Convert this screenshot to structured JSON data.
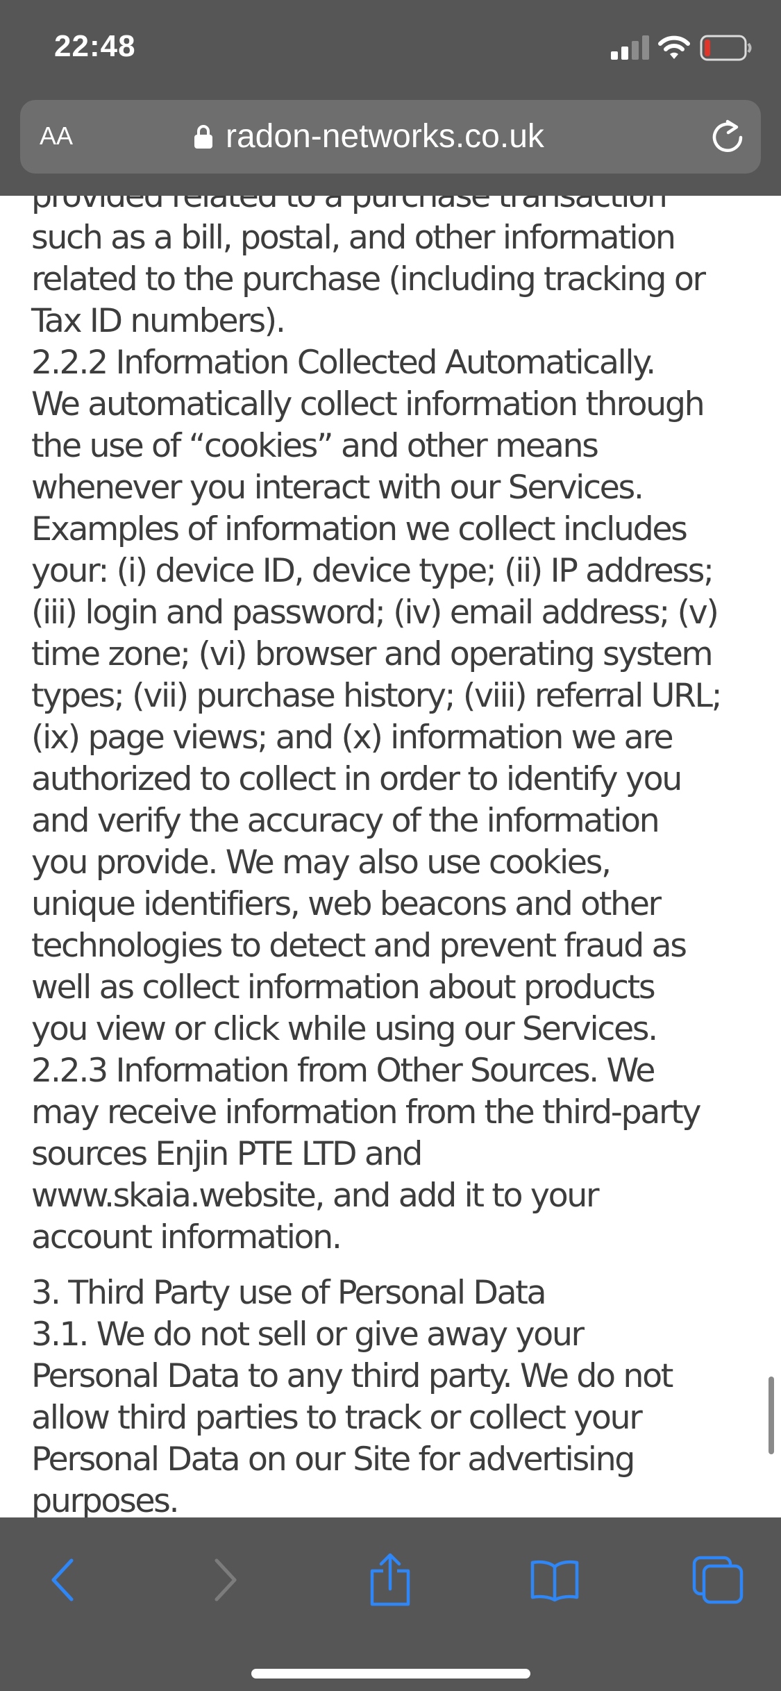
{
  "status_bar": {
    "time": "22:48"
  },
  "url_bar": {
    "text_size_label": "AA",
    "domain": "radon-networks.co.uk",
    "icons": [
      "lock-icon",
      "reload-icon"
    ]
  },
  "content": {
    "paragraph_1": [
      "provided related to a purchase transaction",
      "such as a bill, postal, and other information",
      "related to the purchase (including tracking or",
      "Tax ID numbers).",
      "2.2.2 Information Collected Automatically.",
      "We automatically collect information through",
      "the use of “cookies” and other means",
      "whenever you interact with our Services.",
      "Examples of information we collect includes",
      "your: (i) device ID, device type; (ii) IP address;",
      "(iii) login and password; (iv) email address; (v)",
      "time zone; (vi) browser and operating system",
      "types; (vii) purchase history; (viii) referral URL;",
      "(ix) page views; and (x) information we are",
      "authorized to collect in order to identify you",
      "and verify the accuracy of the information",
      "you provide. We may also use cookies,",
      "unique identifiers, web beacons and other",
      "technologies to detect and prevent fraud as",
      "well as collect information about products",
      "you view or click while using our Services.",
      "2.2.3 Information from Other Sources. We",
      "may receive information from the third-party",
      "sources Enjin PTE LTD and",
      "www.skaia.website, and add it to your",
      "account information."
    ],
    "paragraph_2": [
      "3. Third Party use of Personal Data",
      "3.1. We do not sell or give away your",
      "Personal Data to any third party. We do not",
      "allow third parties to track or collect your",
      "Personal Data on our Site for advertising",
      "purposes."
    ]
  },
  "toolbar": {
    "buttons": [
      "back-icon",
      "forward-icon",
      "share-icon",
      "bookmarks-icon",
      "tabs-icon"
    ]
  },
  "colors": {
    "chrome_background": "#565656",
    "url_field_background": "#6e6e6e",
    "body_text": "#3d3d3d",
    "accent_blue": "#2f86f6",
    "disabled_gray": "#7c7c7c",
    "battery_low_red": "#e0352b"
  }
}
